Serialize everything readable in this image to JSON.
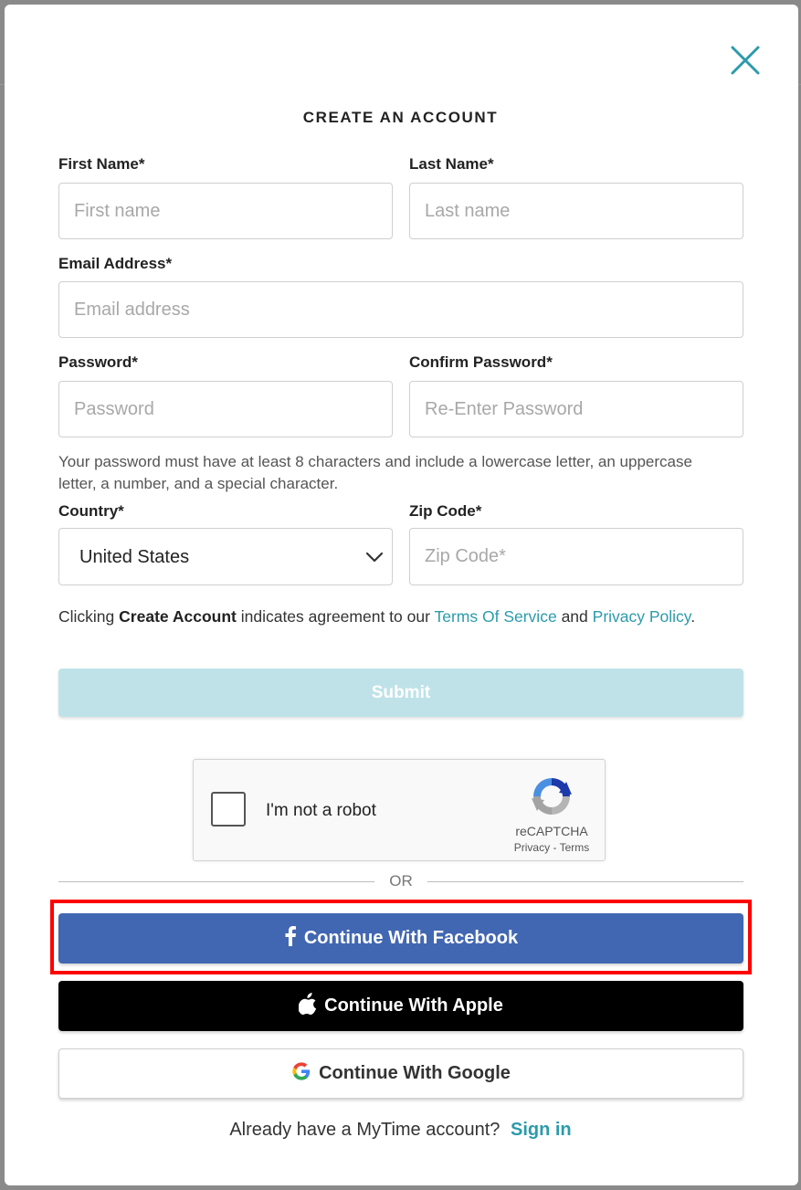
{
  "modal": {
    "title": "CREATE AN ACCOUNT",
    "close_icon": "close-icon"
  },
  "form": {
    "first_name": {
      "label": "First Name*",
      "placeholder": "First name",
      "value": ""
    },
    "last_name": {
      "label": "Last Name*",
      "placeholder": "Last name",
      "value": ""
    },
    "email": {
      "label": "Email Address*",
      "placeholder": "Email address",
      "value": ""
    },
    "password": {
      "label": "Password*",
      "placeholder": "Password",
      "value": ""
    },
    "confirm_password": {
      "label": "Confirm Password*",
      "placeholder": "Re-Enter Password",
      "value": ""
    },
    "password_hint": "Your password must have at least 8 characters and include a lowercase letter, an uppercase letter, a number, and a special character.",
    "country": {
      "label": "Country*",
      "value": "United States"
    },
    "zip": {
      "label": "Zip Code*",
      "placeholder": "Zip Code*",
      "value": ""
    },
    "agreement": {
      "prefix": "Clicking",
      "bold": "Create Account",
      "middle": "indicates agreement to our",
      "terms_link": "Terms Of Service",
      "and": "and",
      "privacy_link": "Privacy Policy",
      "suffix": "."
    },
    "submit_label": "Submit"
  },
  "captcha": {
    "label": "I'm not a robot",
    "brand": "reCAPTCHA",
    "privacy": "Privacy",
    "separator": "-",
    "terms": "Terms"
  },
  "divider": {
    "text": "OR"
  },
  "social": {
    "facebook": {
      "label": "Continue With Facebook",
      "icon": "facebook-icon"
    },
    "apple": {
      "label": "Continue With Apple",
      "icon": "apple-icon"
    },
    "google": {
      "label": "Continue With Google",
      "icon": "google-icon"
    }
  },
  "footer": {
    "prompt": "Already have a MyTime account?",
    "signin_label": "Sign in"
  },
  "colors": {
    "accent": "#2b9bab",
    "submit_disabled": "#bfe2e8",
    "facebook": "#4267b2",
    "apple": "#000000",
    "highlight": "#ff0000"
  }
}
